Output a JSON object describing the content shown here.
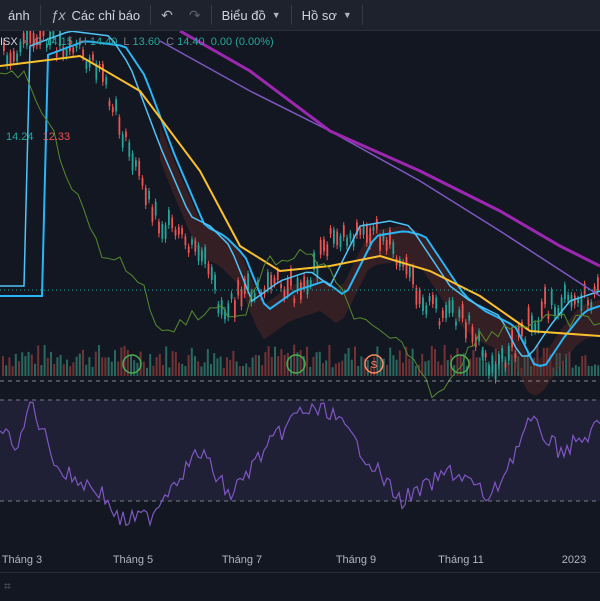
{
  "toolbar": {
    "items": [
      "ánh",
      "Các chỉ báo",
      "Biểu đồ",
      "Hồ sơ"
    ],
    "indicators_icon": "fx-icon",
    "undo_icon": "undo-icon",
    "redo_icon": "redo-icon"
  },
  "legend": {
    "symbol_fragment": "ISX",
    "open_label": "O",
    "open": "14.15",
    "high_label": "H",
    "high": "14.40",
    "low_label": "L",
    "low": "13.60",
    "close_label": "C",
    "close": "14.40",
    "change": "0.00 (0.00%)"
  },
  "indicator_values": [
    "14.24",
    "12.33"
  ],
  "time_axis": [
    "Tháng 3",
    "Tháng 5",
    "Tháng 7",
    "Tháng 9",
    "Tháng 11",
    "2023"
  ],
  "event_markers": [
    "",
    "",
    "S",
    ""
  ],
  "colors": {
    "up": "#26a69a",
    "down": "#ef5350",
    "ma_purple": "#9c27b0",
    "ma_violet": "#7e57c2",
    "ma_yellow": "#fbc02d",
    "ma_blue": "#29b6f6",
    "rsi": "#7e57c2",
    "marker": "#4caf50"
  }
}
